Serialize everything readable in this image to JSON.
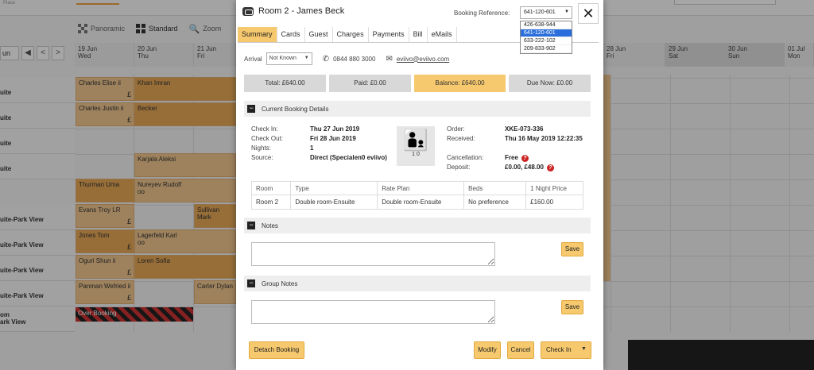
{
  "background": {
    "top_label": "Place",
    "view": {
      "panoramic": "Panoramic",
      "standard": "Standard",
      "zoom": "Zoom"
    },
    "nav": {
      "range": "un",
      "prev": "◀",
      "left": "<",
      "right": ">",
      "next": "»"
    },
    "dates": [
      {
        "d": "19 Jun",
        "w": "Wed"
      },
      {
        "d": "20 Jun",
        "w": "Thu"
      },
      {
        "d": "21 Jun",
        "w": "Fri"
      },
      {
        "d": "28 Jun",
        "w": "Fri"
      },
      {
        "d": "29 Jun",
        "w": "Sat"
      },
      {
        "d": "30 Jun",
        "w": "Sun"
      },
      {
        "d": "01 Jul",
        "w": "Mon"
      }
    ],
    "rooms": [
      "uite",
      "uite",
      "uite",
      "uite",
      "uite-Park View",
      "uite-Park View",
      "uite-Park View",
      "uite-Park View",
      "uite-Park View",
      "om\nark View"
    ],
    "bookings": [
      {
        "name": "Charles Elise",
        "badge": "ii",
        "paid": "£"
      },
      {
        "name": "Khan Imran",
        "badge": "",
        "paid": ""
      },
      {
        "name": "Charles Justin",
        "badge": "ii",
        "paid": "£"
      },
      {
        "name": "Becker",
        "badge": "",
        "paid": ""
      },
      {
        "name": "Karjala Aleksi",
        "badge": "",
        "paid": ""
      },
      {
        "name": "Thurman Uma",
        "badge": "",
        "paid": ""
      },
      {
        "name": "Nureyev Rudolf",
        "badge": "oo",
        "paid": ""
      },
      {
        "name": "Evans Troy",
        "badge": "LR",
        "paid": "£"
      },
      {
        "name": "Sullivan Mark",
        "badge": "",
        "paid": ""
      },
      {
        "name": "Jones Tom",
        "badge": "",
        "paid": "£"
      },
      {
        "name": "Lagerfeld Karl",
        "badge": "oo",
        "paid": ""
      },
      {
        "name": "Oguri Shun",
        "badge": "ii",
        "paid": "£"
      },
      {
        "name": "Loren Sofia",
        "badge": "",
        "paid": ""
      },
      {
        "name": "Panman Wefried",
        "badge": "ii",
        "paid": "£"
      },
      {
        "name": "Carter Dylan",
        "badge": "",
        "paid": ""
      }
    ],
    "overbooking": "Over Booking"
  },
  "modal": {
    "title": "Room 2 - James Beck",
    "booking_ref_label": "Booking Reference:",
    "booking_ref_value": "641-120-601",
    "booking_ref_options": [
      "426-638-944",
      "641-120-601",
      "633-222-102",
      "209-833-902"
    ],
    "close": "✕",
    "tabs": [
      "Summary",
      "Cards",
      "Guest",
      "Charges",
      "Payments",
      "Bill",
      "eMails"
    ],
    "arrival_label": "Arrival",
    "arrival_value": "Not Known",
    "phone": "0844 880 3000",
    "email": "eviivo@eviivo.com",
    "totals": {
      "total": "Total: £640.00",
      "paid": "Paid: £0.00",
      "balance": "Balance: £640.00",
      "due": "Due Now: £0.00"
    },
    "sections": {
      "current": "Current Booking Details",
      "notes": "Notes",
      "group_notes": "Group Notes"
    },
    "details": {
      "checkin_label": "Check In:",
      "checkin_value": "Thu 27 Jun 2019",
      "checkout_label": "Check Out:",
      "checkout_value": "Fri 28 Jun 2019",
      "nights_label": "Nights:",
      "nights_value": "1",
      "source_label": "Source:",
      "source_value": "Direct (Specialen0 eviivo)",
      "guests": "1 0",
      "order_label": "Order:",
      "order_value": "XKE-073-336",
      "received_label": "Received:",
      "received_value": "Thu 16 May 2019 12:22:35",
      "cancellation_label": "Cancellation:",
      "cancellation_value": "Free",
      "deposit_label": "Deposit:",
      "deposit_value": "£0.00, £48.00"
    },
    "room_table": {
      "headers": [
        "Room",
        "Type",
        "Rate Plan",
        "Beds",
        "1 Night Price"
      ],
      "row": [
        "Room 2",
        "Double room-Ensuite",
        "Double room-Ensuite",
        "No preference",
        "£160.00"
      ]
    },
    "buttons": {
      "save": "Save",
      "detach": "Detach Booking",
      "modify": "Modify",
      "cancel": "Cancel",
      "checkin": "Check In"
    },
    "colors": {
      "accent": "#f7c96e",
      "help": "#cc2222",
      "booking": "#f2c88f"
    }
  }
}
